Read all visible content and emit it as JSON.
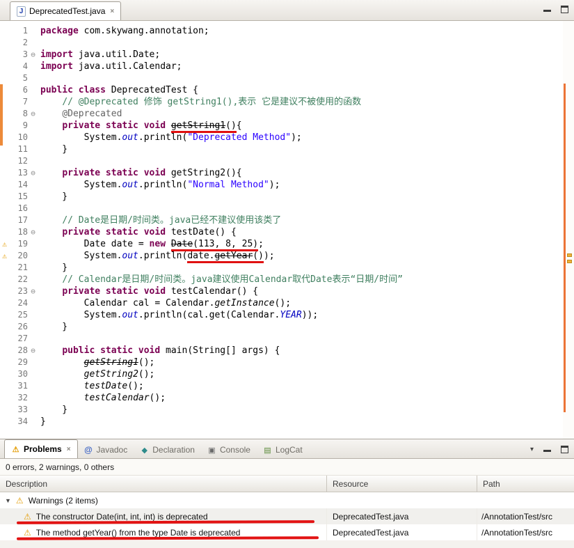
{
  "icons": {
    "warning": "⚠",
    "fold": "⊖",
    "expander": "▼",
    "close": "×",
    "menu": "▾",
    "java_badge": "J",
    "problems": "⚠",
    "javadoc": "@",
    "declaration": "◆",
    "console": "▣",
    "logcat": "▤"
  },
  "editor": {
    "tab_title": "DeprecatedTest.java",
    "lines": [
      {
        "seg": [
          {
            "t": "package ",
            "c": "k"
          },
          {
            "t": "com.skywang.annotation;",
            "c": "p"
          }
        ]
      },
      {
        "seg": []
      },
      {
        "fold": true,
        "seg": [
          {
            "t": "import ",
            "c": "k"
          },
          {
            "t": "java.util.Date;",
            "c": "p"
          }
        ]
      },
      {
        "seg": [
          {
            "t": "import ",
            "c": "k"
          },
          {
            "t": "java.util.Calendar;",
            "c": "p"
          }
        ]
      },
      {
        "seg": []
      },
      {
        "seg": [
          {
            "t": "public class ",
            "c": "k"
          },
          {
            "t": "DeprecatedTest {",
            "c": "p"
          }
        ]
      },
      {
        "seg": [
          {
            "t": "    ",
            "c": "p"
          },
          {
            "t": "// @Deprecated 修饰 getString1(),表示 它是建议不被使用的函数",
            "c": "c"
          }
        ]
      },
      {
        "fold": true,
        "seg": [
          {
            "t": "    ",
            "c": "p"
          },
          {
            "t": "@Deprecated",
            "c": "ann"
          }
        ]
      },
      {
        "seg": [
          {
            "t": "    ",
            "c": "p"
          },
          {
            "t": "private static void ",
            "c": "k"
          },
          {
            "t": "getString1",
            "c": "d u"
          },
          {
            "t": "()",
            "c": "p u"
          },
          {
            "t": "{",
            "c": "p"
          }
        ]
      },
      {
        "seg": [
          {
            "t": "        System.",
            "c": "p"
          },
          {
            "t": "out",
            "c": "f"
          },
          {
            "t": ".println(",
            "c": "p"
          },
          {
            "t": "\"Deprecated Method\"",
            "c": "s"
          },
          {
            "t": ");",
            "c": "p"
          }
        ]
      },
      {
        "seg": [
          {
            "t": "    }",
            "c": "p"
          }
        ]
      },
      {
        "seg": []
      },
      {
        "fold": true,
        "seg": [
          {
            "t": "    ",
            "c": "p"
          },
          {
            "t": "private static void ",
            "c": "k"
          },
          {
            "t": "getString2(){",
            "c": "p"
          }
        ]
      },
      {
        "seg": [
          {
            "t": "        System.",
            "c": "p"
          },
          {
            "t": "out",
            "c": "f"
          },
          {
            "t": ".println(",
            "c": "p"
          },
          {
            "t": "\"Normal Method\"",
            "c": "s"
          },
          {
            "t": ");",
            "c": "p"
          }
        ]
      },
      {
        "seg": [
          {
            "t": "    }",
            "c": "p"
          }
        ]
      },
      {
        "seg": []
      },
      {
        "seg": [
          {
            "t": "    ",
            "c": "p"
          },
          {
            "t": "// Date是日期/时间类。java已经不建议使用该类了",
            "c": "c"
          }
        ]
      },
      {
        "fold": true,
        "seg": [
          {
            "t": "    ",
            "c": "p"
          },
          {
            "t": "private static void ",
            "c": "k"
          },
          {
            "t": "testDate() {",
            "c": "p"
          }
        ]
      },
      {
        "warn": true,
        "seg": [
          {
            "t": "        Date date = ",
            "c": "p"
          },
          {
            "t": "new ",
            "c": "k"
          },
          {
            "t": "Date",
            "c": "d u"
          },
          {
            "t": "(113, 8, 25)",
            "c": "p u"
          },
          {
            "t": ";",
            "c": "p"
          }
        ]
      },
      {
        "warn": true,
        "seg": [
          {
            "t": "        System.",
            "c": "p"
          },
          {
            "t": "out",
            "c": "f"
          },
          {
            "t": ".println(",
            "c": "p"
          },
          {
            "t": "date.",
            "c": "p u"
          },
          {
            "t": "getYear",
            "c": "d u"
          },
          {
            "t": "()",
            "c": "p u"
          },
          {
            "t": ");",
            "c": "p"
          }
        ]
      },
      {
        "seg": [
          {
            "t": "    }",
            "c": "p"
          }
        ]
      },
      {
        "seg": [
          {
            "t": "    ",
            "c": "p"
          },
          {
            "t": "// Calendar是日期/时间类。java建议使用Calendar取代Date表示“日期/时间”",
            "c": "c"
          }
        ]
      },
      {
        "fold": true,
        "seg": [
          {
            "t": "    ",
            "c": "p"
          },
          {
            "t": "private static void ",
            "c": "k"
          },
          {
            "t": "testCalendar() {",
            "c": "p"
          }
        ]
      },
      {
        "seg": [
          {
            "t": "        Calendar cal = Calendar.",
            "c": "p"
          },
          {
            "t": "getInstance",
            "c": "m"
          },
          {
            "t": "();",
            "c": "p"
          }
        ]
      },
      {
        "seg": [
          {
            "t": "        System.",
            "c": "p"
          },
          {
            "t": "out",
            "c": "f"
          },
          {
            "t": ".println(cal.get(Calendar.",
            "c": "p"
          },
          {
            "t": "YEAR",
            "c": "f"
          },
          {
            "t": "));",
            "c": "p"
          }
        ]
      },
      {
        "seg": [
          {
            "t": "    }",
            "c": "p"
          }
        ]
      },
      {
        "seg": []
      },
      {
        "fold": true,
        "seg": [
          {
            "t": "    ",
            "c": "p"
          },
          {
            "t": "public static void ",
            "c": "k"
          },
          {
            "t": "main(String[] args) {",
            "c": "p"
          }
        ]
      },
      {
        "seg": [
          {
            "t": "        ",
            "c": "p"
          },
          {
            "t": "getString1",
            "c": "dm"
          },
          {
            "t": "();",
            "c": "p"
          }
        ]
      },
      {
        "seg": [
          {
            "t": "        ",
            "c": "p"
          },
          {
            "t": "getString2",
            "c": "m"
          },
          {
            "t": "();",
            "c": "p"
          }
        ]
      },
      {
        "seg": [
          {
            "t": "        ",
            "c": "p"
          },
          {
            "t": "testDate",
            "c": "m"
          },
          {
            "t": "();",
            "c": "p"
          }
        ]
      },
      {
        "seg": [
          {
            "t": "        ",
            "c": "p"
          },
          {
            "t": "testCalendar",
            "c": "m"
          },
          {
            "t": "();",
            "c": "p"
          }
        ]
      },
      {
        "seg": [
          {
            "t": "    }",
            "c": "p"
          }
        ]
      },
      {
        "seg": [
          {
            "t": "}",
            "c": "p"
          }
        ]
      }
    ]
  },
  "problems": {
    "tabs": [
      {
        "label": "Problems",
        "icon": "problems",
        "active": true,
        "closable": true
      },
      {
        "label": "Javadoc",
        "icon": "javadoc",
        "active": false
      },
      {
        "label": "Declaration",
        "icon": "declaration",
        "active": false
      },
      {
        "label": "Console",
        "icon": "console",
        "active": false
      },
      {
        "label": "LogCat",
        "icon": "logcat",
        "active": false
      }
    ],
    "summary": "0 errors, 2 warnings, 0 others",
    "columns": [
      "Description",
      "Resource",
      "Path"
    ],
    "rows": [
      {
        "type": "group",
        "label": "Warnings (2 items)"
      },
      {
        "type": "item",
        "shaded": true,
        "desc": "The constructor Date(int, int, int) is deprecated",
        "resource": "DeprecatedTest.java",
        "path": "/AnnotationTest/src"
      },
      {
        "type": "item",
        "shaded": false,
        "desc": "The method getYear() from the type Date is deprecated",
        "resource": "DeprecatedTest.java",
        "path": "/AnnotationTest/src"
      }
    ]
  }
}
